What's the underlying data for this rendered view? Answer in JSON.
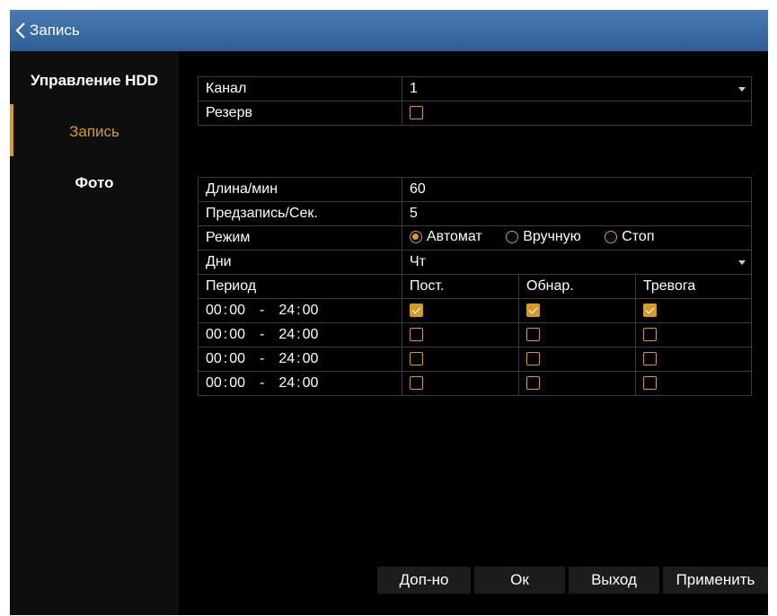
{
  "title": "Запись",
  "sidebar": {
    "items": [
      "Управление HDD",
      "Запись",
      "Фото"
    ],
    "active": "Запись"
  },
  "channel": {
    "label": "Канал",
    "value": "1",
    "reserve_label": "Резерв",
    "reserve_checked": false
  },
  "settings": {
    "length_label": "Длина/мин",
    "length_value": "60",
    "prerecord_label": "Предзапись/Сек.",
    "prerecord_value": "5",
    "mode_label": "Режим",
    "modes": [
      "Автомат",
      "Вручную",
      "Стоп"
    ],
    "mode_selected": "Автомат",
    "days_label": "Дни",
    "days_value": "Чт"
  },
  "schedule": {
    "headers": [
      "Период",
      "Пост.",
      "Обнар.",
      "Тревога"
    ],
    "rows": [
      {
        "start_h": "00",
        "start_m": "00",
        "end_h": "24",
        "end_m": "00",
        "sep": "-",
        "const": true,
        "detect": true,
        "alarm": true
      },
      {
        "start_h": "00",
        "start_m": "00",
        "end_h": "24",
        "end_m": "00",
        "sep": "-",
        "const": false,
        "detect": false,
        "alarm": false
      },
      {
        "start_h": "00",
        "start_m": "00",
        "end_h": "24",
        "end_m": "00",
        "sep": "-",
        "const": false,
        "detect": false,
        "alarm": false
      },
      {
        "start_h": "00",
        "start_m": "00",
        "end_h": "24",
        "end_m": "00",
        "sep": "-",
        "const": false,
        "detect": false,
        "alarm": false
      }
    ]
  },
  "buttons": {
    "extra": "Доп-но",
    "ok": "Ок",
    "exit": "Выход",
    "apply": "Применить"
  },
  "colors": {
    "accent": "#d59a2b",
    "titlebar": "#3b6ba5",
    "background": "#000000",
    "grid": "#3a3a3a"
  }
}
